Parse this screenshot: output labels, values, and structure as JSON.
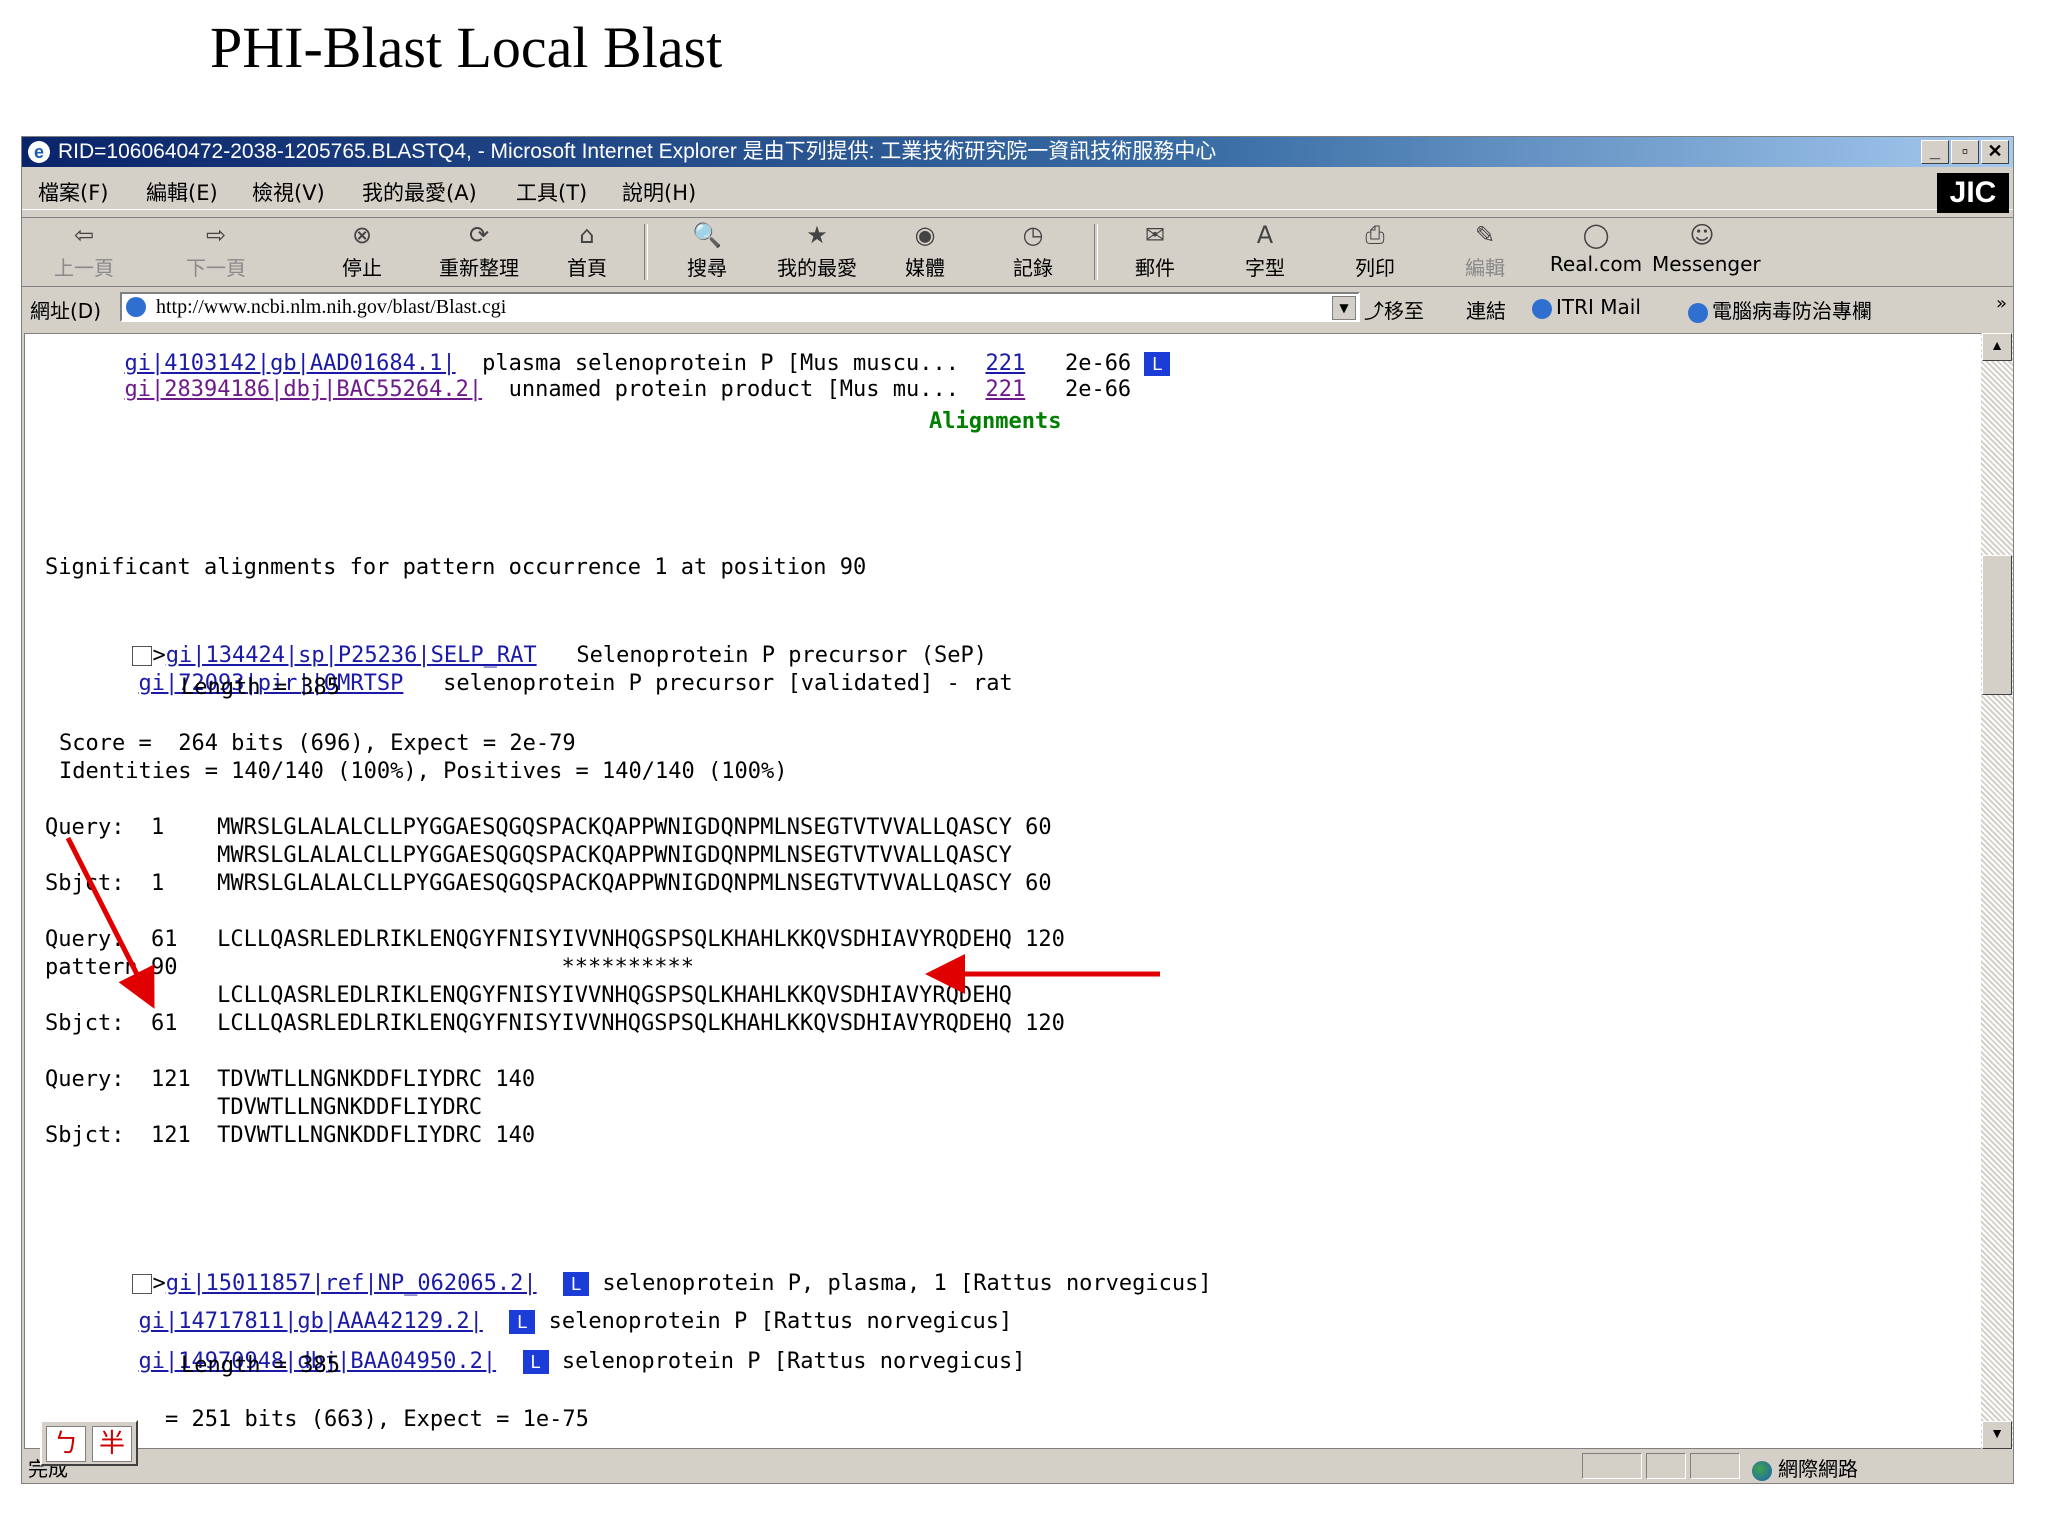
{
  "slide": {
    "title": "PHI-Blast Local Blast"
  },
  "window": {
    "title": "RID=1060640472-2038-1205765.BLASTQ4, - Microsoft Internet Explorer 是由下列提供: 工業技術研究院一資訊技術服務中心",
    "controls": [
      "_",
      "▫",
      "✕"
    ]
  },
  "menu": [
    "檔案(F)",
    "編輯(E)",
    "檢視(V)",
    "我的最愛(A)",
    "工具(T)",
    "說明(H)"
  ],
  "toolbar": [
    {
      "label": "上一頁",
      "icon": "back-arrow-icon",
      "glyph": "⇦"
    },
    {
      "label": "下一頁",
      "icon": "forward-arrow-icon",
      "glyph": "⇨"
    },
    {
      "label": "停止",
      "icon": "stop-icon",
      "glyph": "⊗"
    },
    {
      "label": "重新整理",
      "icon": "refresh-icon",
      "glyph": "⟳"
    },
    {
      "label": "首頁",
      "icon": "home-icon",
      "glyph": "⌂"
    },
    {
      "label": "搜尋",
      "icon": "search-icon",
      "glyph": "🔍"
    },
    {
      "label": "我的最愛",
      "icon": "favorites-icon",
      "glyph": "★"
    },
    {
      "label": "媒體",
      "icon": "media-icon",
      "glyph": "◉"
    },
    {
      "label": "記錄",
      "icon": "history-icon",
      "glyph": "◷"
    },
    {
      "label": "郵件",
      "icon": "mail-icon",
      "glyph": "✉"
    },
    {
      "label": "字型",
      "icon": "font-icon",
      "glyph": "A"
    },
    {
      "label": "列印",
      "icon": "print-icon",
      "glyph": "⎙"
    },
    {
      "label": "編輯",
      "icon": "edit-icon",
      "glyph": "✎"
    },
    {
      "label": "Real.com",
      "icon": "real-icon",
      "glyph": "◯"
    },
    {
      "label": "Messenger",
      "icon": "messenger-icon",
      "glyph": "☺"
    }
  ],
  "address": {
    "label": "網址(D)",
    "url": "http://www.ncbi.nlm.nih.gov/blast/Blast.cgi",
    "go": "⤴移至",
    "links_label": "連結",
    "links": [
      "ITRI Mail",
      "電腦病毒防治專欄"
    ],
    "more": "»"
  },
  "content": {
    "top_hits": [
      {
        "id": "gi|4103142|gb|AAD01684.1|",
        "desc": "plasma selenoprotein P [Mus muscu...",
        "score": "221",
        "evalue": "2e-66"
      },
      {
        "id": "gi|28394186|dbj|BAC55264.2|",
        "desc": "unnamed protein product [Mus mu...",
        "score": "221",
        "evalue": "2e-66"
      }
    ],
    "alignments_heading": "Alignments",
    "significant": "Significant alignments for pattern occurrence 1 at position 90",
    "hit1": {
      "prefix": ">",
      "id": "gi|134424|sp|P25236|SELP_RAT",
      "desc": "Selenoprotein P precursor (SeP)",
      "id2": "gi|72093|pir||OMRTSP",
      "desc2": "selenoprotein P precursor [validated] - rat",
      "length": "Length = 385",
      "score": "Score =  264 bits (696), Expect = 2e-79",
      "identities": "Identities = 140/140 (100%), Positives = 140/140 (100%)",
      "block1": [
        "Query:  1    MWRSLGLALALCLLPYGGAESQGQSPACKQAPPWNIGDQNPMLNSEGTVTVVALLQASCY 60",
        "             MWRSLGLALALCLLPYGGAESQGQSPACKQAPPWNIGDQNPMLNSEGTVTVVALLQASCY",
        "Sbjct:  1    MWRSLGLALALCLLPYGGAESQGQSPACKQAPPWNIGDQNPMLNSEGTVTVVALLQASCY 60"
      ],
      "block2": [
        "Query:  61   LCLLQASRLEDLRIKLENQGYFNISYIVVNHQGSPSQLKHAHLKKQVSDHIAVYRQDEHQ 120",
        "pattern 90                             **********",
        "             LCLLQASRLEDLRIKLENQGYFNISYIVVNHQGSPSQLKHAHLKKQVSDHIAVYRQDEHQ",
        "Sbjct:  61   LCLLQASRLEDLRIKLENQGYFNISYIVVNHQGSPSQLKHAHLKKQVSDHIAVYRQDEHQ 120"
      ],
      "block3": [
        "Query:  121  TDVWTLLNGNKDDFLIYDRC 140",
        "             TDVWTLLNGNKDDFLIYDRC",
        "Sbjct:  121  TDVWTLLNGNKDDFLIYDRC 140"
      ]
    },
    "hit2": {
      "prefix": ">",
      "id": "gi|15011857|ref|NP_062065.2|",
      "desc": "selenoprotein P, plasma, 1 [Rattus norvegicus]",
      "id2": "gi|14717811|gb|AAA42129.2|",
      "desc2": "selenoprotein P [Rattus norvegicus]",
      "id3": "gi|14970948|dbj|BAA04950.2|",
      "desc3": "selenoprotein P [Rattus norvegicus]",
      "length": "Length = 385",
      "score_partial": "= 251 bits (663), Expect = 1e-75",
      "link_badge": "L"
    }
  },
  "status": {
    "left": "完成",
    "zone": "網際網路"
  },
  "ime": {
    "a": "ㄅ",
    "b": "半"
  },
  "colors": {
    "annotation_arrow": "#e00000",
    "link": "#1a1aa6",
    "heading": "#008000"
  }
}
